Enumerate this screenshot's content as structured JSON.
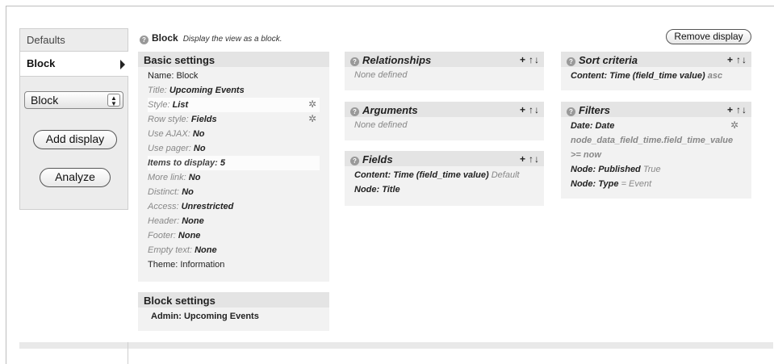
{
  "tabs": {
    "defaults": "Defaults",
    "block": "Block",
    "select_value": "Block",
    "add_display": "Add display",
    "analyze": "Analyze"
  },
  "header": {
    "title": "Block",
    "description": "Display the view as a block.",
    "remove_display": "Remove display"
  },
  "basic_settings": {
    "title": "Basic settings",
    "rows": [
      {
        "label": "Name:",
        "value": "Block"
      },
      {
        "label": "Title:",
        "value": "Upcoming Events"
      },
      {
        "label": "Style:",
        "value": "List"
      },
      {
        "label": "Row style:",
        "value": "Fields"
      },
      {
        "label": "Use AJAX:",
        "value": "No"
      },
      {
        "label": "Use pager:",
        "value": "No"
      },
      {
        "label": "Items to display:",
        "value": "5"
      },
      {
        "label": "More link:",
        "value": "No"
      },
      {
        "label": "Distinct:",
        "value": "No"
      },
      {
        "label": "Access:",
        "value": "Unrestricted"
      },
      {
        "label": "Header:",
        "value": "None"
      },
      {
        "label": "Footer:",
        "value": "None"
      },
      {
        "label": "Empty text:",
        "value": "None"
      },
      {
        "label": "Theme:",
        "value": "Information"
      }
    ]
  },
  "block_settings": {
    "title": "Block settings",
    "admin": "Admin: Upcoming Events"
  },
  "relationships": {
    "title": "Relationships",
    "empty": "None defined"
  },
  "arguments": {
    "title": "Arguments",
    "empty": "None defined"
  },
  "fields": {
    "title": "Fields",
    "row1_label": "Content: Time (field_time value)",
    "row1_extra": "Default",
    "row2_label": "Node: Title"
  },
  "sort_criteria": {
    "title": "Sort criteria",
    "row1_label": "Content: Time (field_time value)",
    "row1_extra": "asc"
  },
  "filters": {
    "title": "Filters",
    "row1": "Date: Date",
    "row2": "node_data_field_time.field_time_value",
    "row3": ">= now",
    "row4_label": "Node: Published",
    "row4_value": "True",
    "row5_label": "Node: Type",
    "row5_value": "= Event"
  },
  "tools": {
    "add": "+",
    "rearrange": "↑↓"
  },
  "icons": {
    "help": "help-icon",
    "gear": "gear-icon"
  }
}
